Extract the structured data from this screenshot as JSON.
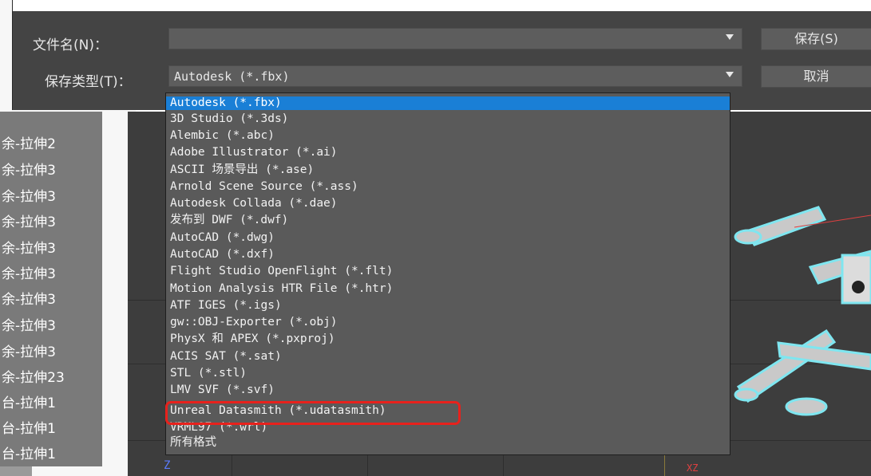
{
  "dialog": {
    "filename_label": "文件名(N)：",
    "filename_value": "",
    "filetype_label": "保存类型(T)：",
    "filetype_value": "Autodesk (*.fbx)",
    "save_button": "保存(S)",
    "cancel_button": "取消"
  },
  "dropdown": {
    "options": [
      "Autodesk (*.fbx)",
      "3D Studio (*.3ds)",
      "Alembic (*.abc)",
      "Adobe Illustrator (*.ai)",
      "ASCII 场景导出 (*.ase)",
      "Arnold Scene Source (*.ass)",
      "Autodesk Collada (*.dae)",
      "发布到 DWF (*.dwf)",
      "AutoCAD (*.dwg)",
      "AutoCAD (*.dxf)",
      "Flight Studio OpenFlight (*.flt)",
      "Motion Analysis HTR File (*.htr)",
      "ATF IGES (*.igs)",
      "gw::OBJ-Exporter (*.obj)",
      "PhysX 和 APEX (*.pxproj)",
      "ACIS SAT (*.sat)",
      "STL (*.stl)",
      "LMV SVF (*.svf)",
      "Unreal Datasmith (*.udatasmith)",
      "VRML97 (*.wrl)",
      "所有格式"
    ],
    "selected": "Autodesk (*.fbx)",
    "highlighted_option": "Unreal Datasmith (*.udatasmith)"
  },
  "scene_list": {
    "items": [
      "余-拉伸2",
      "余-拉伸3",
      "余-拉伸3",
      "余-拉伸3",
      "余-拉伸3",
      "余-拉伸3",
      "余-拉伸3",
      "余-拉伸3",
      "余-拉伸3",
      "余-拉伸23",
      "台-拉伸1",
      "台-拉伸1",
      "台-拉伸1"
    ]
  },
  "viewport": {
    "z_axis_label": "Z",
    "xy_label": "XZ"
  },
  "colors": {
    "dialog_bg": "#444444",
    "selection_blue": "#1a7fd6",
    "highlight_red": "#e8211c",
    "drone_outline": "#7fe6f0"
  }
}
